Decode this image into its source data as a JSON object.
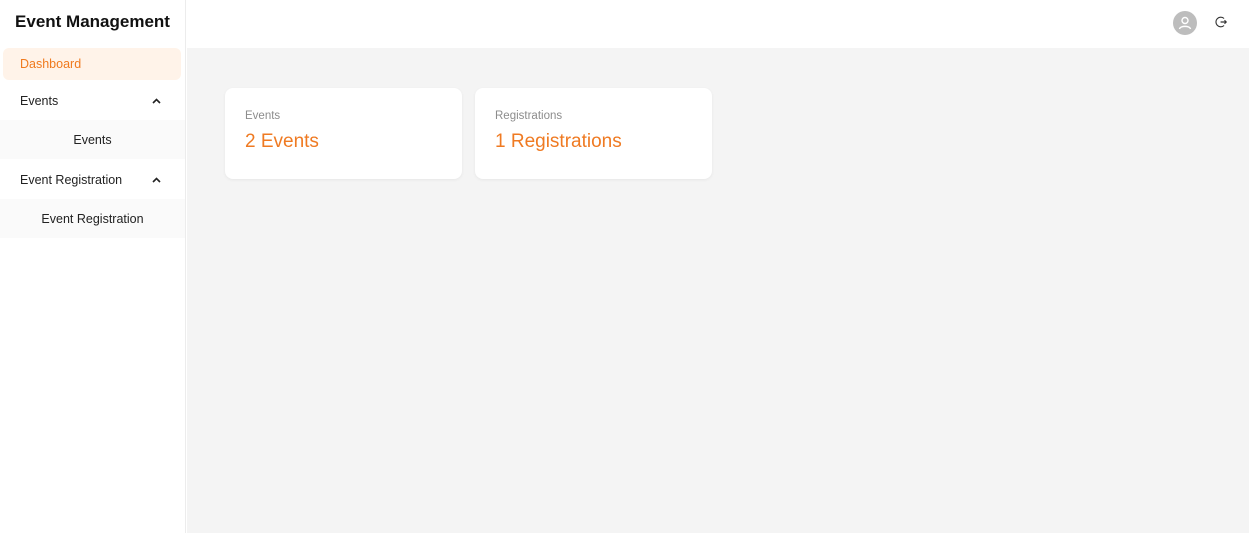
{
  "app": {
    "title": "Event Management"
  },
  "sidebar": {
    "dashboard": "Dashboard",
    "groups": [
      {
        "label": "Events",
        "children": [
          "Events"
        ]
      },
      {
        "label": "Event Registration",
        "children": [
          "Event Registration"
        ]
      }
    ]
  },
  "header": {
    "avatar_icon": "user-icon",
    "logout_icon": "logout-icon"
  },
  "cards": [
    {
      "label": "Events",
      "value": "2 Events"
    },
    {
      "label": "Registrations",
      "value": "1 Registrations"
    }
  ],
  "colors": {
    "accent": "#ef7a22",
    "active_bg": "#fff3e9",
    "content_bg": "#f4f4f4"
  }
}
